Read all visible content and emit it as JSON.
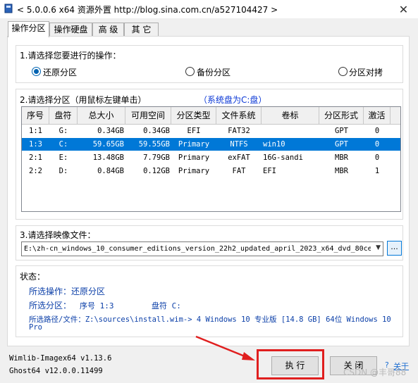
{
  "window": {
    "title": "< 5.0.0.6 x64 资源外置 http://blog.sina.com.cn/a527104427 >",
    "close": "✕"
  },
  "tabs": [
    "操作分区",
    "操作硬盘",
    "高  级",
    "其  它"
  ],
  "operation": {
    "label": "1.请选择您要进行的操作：",
    "options": [
      "还原分区",
      "备份分区",
      "分区对拷"
    ],
    "selected_index": 0
  },
  "partition": {
    "label": "2.请选择分区（用鼠标左键单击）",
    "system_note": "（系统盘为C:盘）",
    "columns": [
      "序号",
      "盘符",
      "总大小",
      "可用空间",
      "分区类型",
      "文件系统",
      "卷标",
      "分区形式",
      "激活"
    ],
    "rows": [
      [
        "1:1",
        "G:",
        "0.34GB",
        "0.34GB",
        "EFI",
        "FAT32",
        "",
        "GPT",
        "0"
      ],
      [
        "1:3",
        "C:",
        "59.65GB",
        "59.55GB",
        "Primary",
        "NTFS",
        "win10",
        "GPT",
        "0"
      ],
      [
        "2:1",
        "E:",
        "13.48GB",
        "7.79GB",
        "Primary",
        "exFAT",
        "16G-sandi",
        "MBR",
        "0"
      ],
      [
        "2:2",
        "D:",
        "0.84GB",
        "0.12GB",
        "Primary",
        "FAT",
        "EFI",
        "MBR",
        "1"
      ]
    ],
    "selected_row": 1
  },
  "image": {
    "label": "3.请选择映像文件：",
    "value": "E:\\zh-cn_windows_10_consumer_editions_version_22h2_updated_april_2023_x64_dvd_80ce",
    "browse": "..."
  },
  "status": {
    "label": "状态：",
    "op_line": "所选操作：还原分区",
    "part_label": "所选分区：",
    "part_no": "序号 1:3",
    "part_drive": "盘符 C:",
    "path_line1": "所选路径/文件：Z:\\sources\\install.wim-> 4 Windows 10 专业版 [14.8 GB] 64位 Windows 10",
    "path_line2": "Pro"
  },
  "footer": {
    "wimlib": "Wimlib-Imagex64 v1.13.6",
    "ghost": "Ghost64 v12.0.0.11499",
    "execute": "执 行",
    "close": "关 闭",
    "about": "关于",
    "help": "?",
    "watermark": "CSDN @丰哥88"
  },
  "colors": {
    "selection": "#0078d7",
    "status_text": "#0b3fa8",
    "highlight_box": "#e01f1f",
    "arrow": "#e01f1f"
  }
}
